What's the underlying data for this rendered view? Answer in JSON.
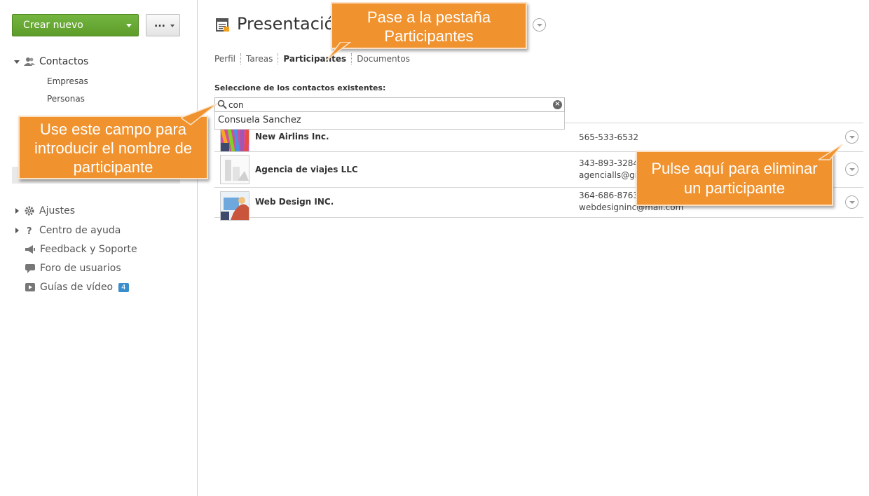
{
  "sidebar": {
    "create_label": "Crear nuevo",
    "more_label": "...",
    "contacts_label": "Contactos",
    "subitems": [
      "Empresas",
      "Personas"
    ],
    "items": [
      {
        "label": "Ajustes",
        "icon": "gear-icon"
      },
      {
        "label": "Centro de ayuda",
        "icon": "question-icon"
      },
      {
        "label": "Feedback y Soporte",
        "icon": "megaphone-icon"
      },
      {
        "label": "Foro de usuarios",
        "icon": "speech-bubble-icon"
      },
      {
        "label": "Guías de vídeo",
        "icon": "video-icon",
        "badge": "4"
      }
    ]
  },
  "main": {
    "title": "Presentación",
    "tabs": [
      "Perfil",
      "Tareas",
      "Participantes",
      "Documentos"
    ],
    "active_tab": "Participantes",
    "select_label": "Seleccione de los contactos existentes:",
    "search_value": "con",
    "suggestion": "Consuela Sanchez",
    "participants": [
      {
        "name": "New Airlins Inc.",
        "phone": "565-533-6532",
        "email": ""
      },
      {
        "name": "Agencia de viajes LLC",
        "phone": "343-893-3284",
        "email": "agencialls@gm"
      },
      {
        "name": "Web Design INC.",
        "phone": "364-686-8763",
        "email": "webdesigninc@mail.com"
      }
    ]
  },
  "callouts": {
    "tabs": [
      "Pase a la pestaña",
      "Participantes"
    ],
    "field": [
      "Use este campo para",
      "introducir el nombre de",
      "participante"
    ],
    "remove": [
      "Pulse aquí para eliminar",
      "un participante"
    ]
  },
  "colors": {
    "accent_green": "#5d9c2a",
    "callout_orange": "#f0922e",
    "badge_blue": "#3a8dcb"
  }
}
